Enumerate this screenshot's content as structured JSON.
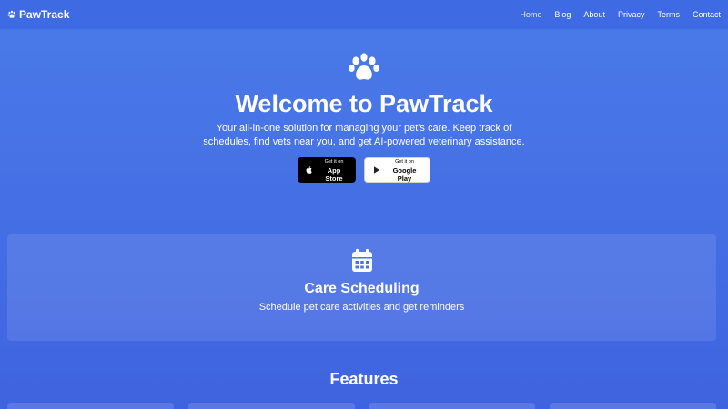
{
  "brand": {
    "name": "PawTrack",
    "icon": "paw-icon"
  },
  "nav": {
    "items": [
      {
        "label": "Home",
        "active": true
      },
      {
        "label": "Blog"
      },
      {
        "label": "About"
      },
      {
        "label": "Privacy"
      },
      {
        "label": "Terms"
      },
      {
        "label": "Contact"
      }
    ]
  },
  "hero": {
    "icon": "paw-icon",
    "title": "Welcome to PawTrack",
    "description": "Your all-in-one solution for managing your pet's care. Keep track of schedules, find vets near you, and get AI-powered veterinary assistance.",
    "app_store": {
      "small": "Get it on",
      "big": "App Store",
      "icon": "apple-icon"
    },
    "google_play": {
      "small": "Get it on",
      "big": "Google Play",
      "icon": "play-icon"
    }
  },
  "feature_card": {
    "icon": "calendar-icon",
    "title": "Care Scheduling",
    "description": "Schedule pet care activities and get reminders"
  },
  "features": {
    "heading": "Features"
  },
  "colors": {
    "background": "#4672e6",
    "navbar": "#3e6ae4",
    "text": "#ffffff"
  }
}
